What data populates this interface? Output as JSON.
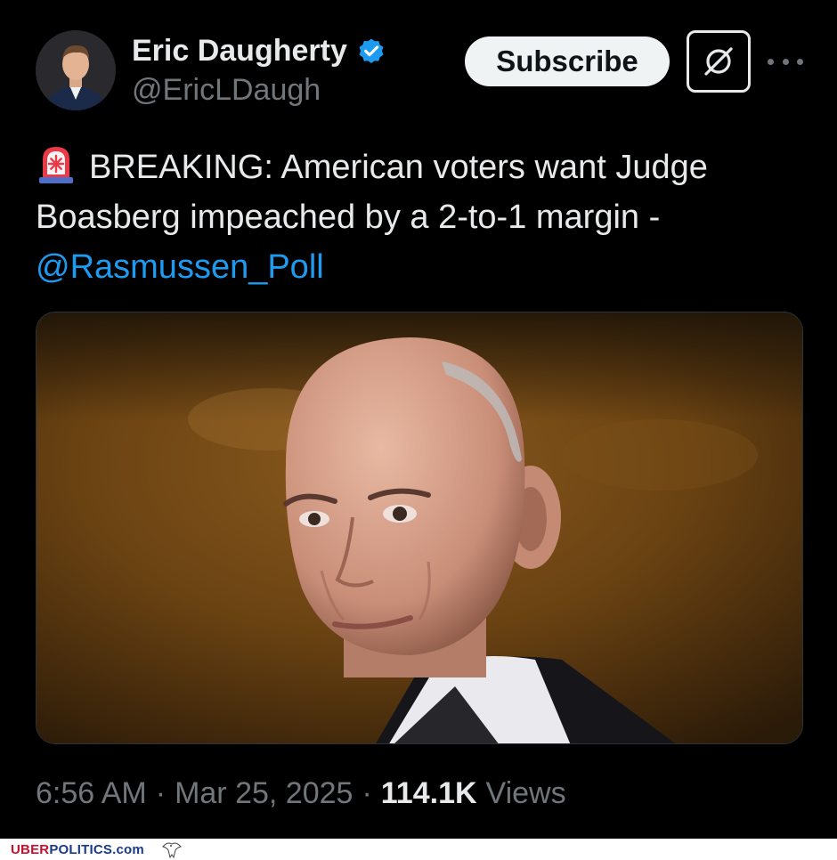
{
  "author": {
    "display_name": "Eric Daugherty",
    "handle": "@EricLDaugh",
    "avatar_icon": "profile-photo",
    "verified_icon": "verified-badge-icon",
    "verified_color": "#1d9bf0"
  },
  "actions": {
    "subscribe_label": "Subscribe",
    "grok_icon": "grok-icon",
    "more_icon": "more-options-icon"
  },
  "tweet": {
    "siren_icon": "rotating-light-emoji",
    "text_main": "BREAKING: American voters want Judge Boasberg impeached by a 2-to-1 margin -",
    "mention": "@Rasmussen_Poll",
    "mention_color": "#1d9bf0"
  },
  "meta": {
    "time": "6:56 AM",
    "separator": "·",
    "date": "Mar 25, 2025",
    "views_count": "114.1K",
    "views_label": "Views"
  },
  "watermark": {
    "brand_part1": "UBER",
    "brand_part2": "POLITICS.com",
    "logo_icon": "eagle-icon"
  },
  "colors": {
    "background": "#000000",
    "text_primary": "#e7e9ea",
    "text_secondary": "#71767b",
    "watermark_red": "#c8102e",
    "watermark_blue": "#1a3a8a"
  }
}
